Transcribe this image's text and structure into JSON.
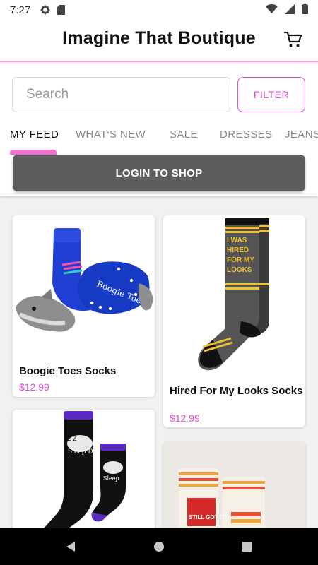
{
  "status_bar": {
    "time": "7:27",
    "icons": [
      "gear-icon",
      "sd-card-icon",
      "wifi-icon",
      "signal-icon",
      "battery-icon"
    ]
  },
  "header": {
    "title": "Imagine That Boutique",
    "cart_icon": "shopping-cart-icon"
  },
  "search": {
    "placeholder": "Search",
    "filter_label": "FILTER"
  },
  "tabs": [
    {
      "label": "MY FEED",
      "active": true
    },
    {
      "label": "WHAT'S NEW",
      "active": false
    },
    {
      "label": "SALE",
      "active": false
    },
    {
      "label": "DRESSES",
      "active": false
    },
    {
      "label": "JEANS",
      "active": false
    }
  ],
  "login": {
    "label": "LOGIN TO SHOP"
  },
  "products": [
    {
      "name": "Boogie Toes Socks",
      "price": "$12.99",
      "image_text": "Boogie Toes"
    },
    {
      "name": "Hired For My Looks Socks",
      "price": "$12.99",
      "image_text": "I WAS HIRED FOR MY LOOKS"
    },
    {
      "name": "",
      "price": "",
      "image_text": "Sleep Deprived"
    },
    {
      "name": "",
      "price": "",
      "image_text": "STILL GOT IT"
    }
  ],
  "colors": {
    "accent": "#e24fcf",
    "tab_indicator": "#f06fcf",
    "header_rule": "#f2a3dc",
    "login_bg": "#5d5d5d"
  },
  "nav": {
    "icons": [
      "back-icon",
      "home-icon",
      "recents-icon"
    ]
  }
}
